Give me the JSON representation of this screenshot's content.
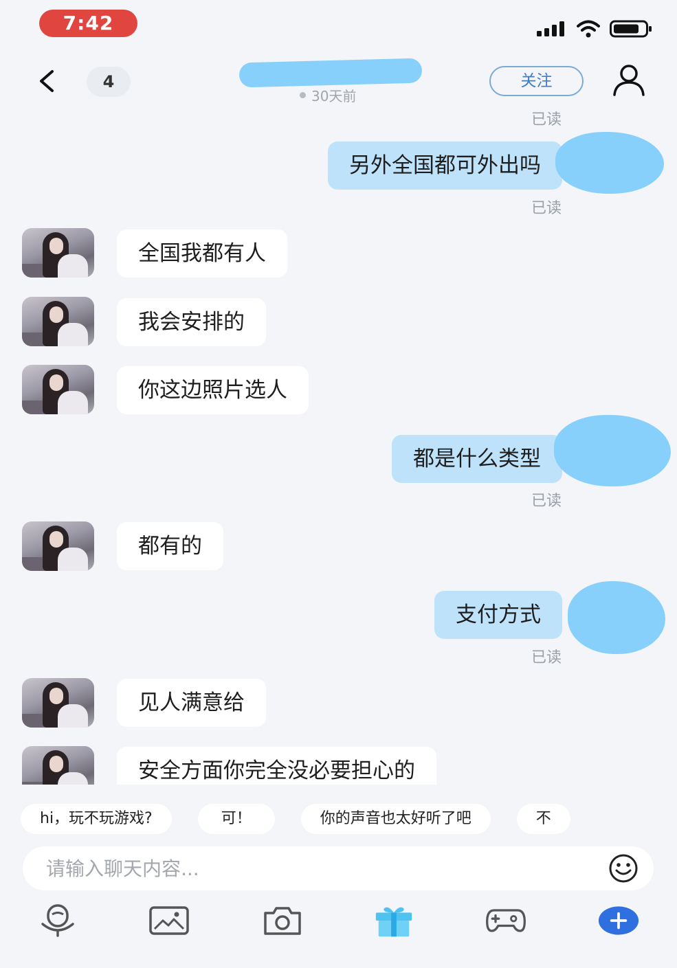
{
  "status_bar": {
    "time": "7:42",
    "icons": [
      "signal-icon",
      "wifi-icon",
      "battery-icon"
    ]
  },
  "header": {
    "back_icon": "chevron-left-icon",
    "unread_count": "4",
    "presence": "30天前",
    "follow_label": "关注",
    "profile_icon": "user-icon"
  },
  "messages": [
    {
      "from": "me",
      "text": "另外全国都可外出吗",
      "status": "已读"
    },
    {
      "from": "them",
      "text": "全国我都有人"
    },
    {
      "from": "them",
      "text": "我会安排的"
    },
    {
      "from": "them",
      "text": "你这边照片选人"
    },
    {
      "from": "me",
      "text": "都是什么类型",
      "status": "已读"
    },
    {
      "from": "them",
      "text": "都有的"
    },
    {
      "from": "me",
      "text": "支付方式",
      "status": "已读"
    },
    {
      "from": "them",
      "text": "见人满意给"
    },
    {
      "from": "them",
      "text": "安全方面你完全没必要担心的"
    }
  ],
  "top_read_status": "已读",
  "quick_replies": [
    "hi，玩不玩游戏?",
    "可！",
    "你的声音也太好听了吧",
    "不"
  ],
  "input": {
    "placeholder": "请输入聊天内容...",
    "emoji_icon": "smiley-icon"
  },
  "toolbar": [
    "voice-icon",
    "image-icon",
    "camera-icon",
    "gift-icon",
    "gamepad-icon",
    "plus-icon"
  ],
  "colors": {
    "accent": "#3c7bd3",
    "outgoing_bubble": "#bfe2fb",
    "incoming_bubble": "#ffffff",
    "time_pill": "#e0463f",
    "plus_button": "#2f6fe0"
  }
}
